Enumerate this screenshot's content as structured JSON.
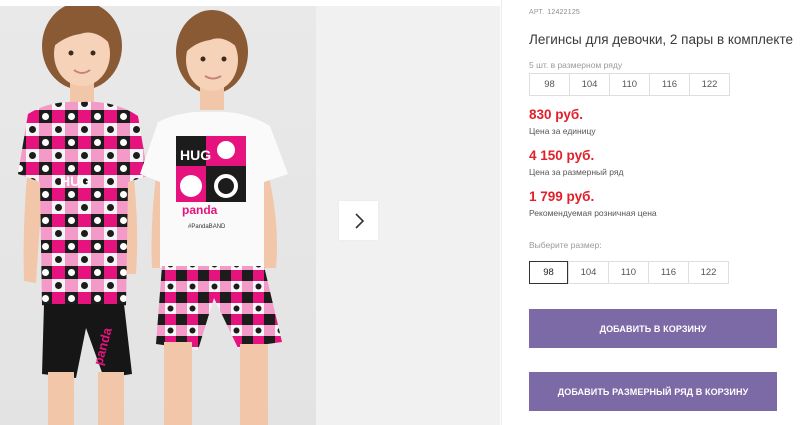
{
  "product": {
    "article_label": "АРТ.",
    "article_value": "12422125",
    "title": "Легинсы для девочки, 2 пары в комплекте"
  },
  "gallery": {
    "next_icon": "chevron-right-icon",
    "print_text_1": "HUG",
    "print_text_2": "panda",
    "print_text_3": "#PandaBAND",
    "print_text_4": "HUG",
    "print_text_5": "panda"
  },
  "row_sizes": {
    "label": "5 шт. в размерном ряду",
    "items": [
      "98",
      "104",
      "110",
      "116",
      "122"
    ]
  },
  "prices": {
    "unit_price": "830 руб.",
    "unit_label": "Цена за единицу",
    "row_price": "4 150 руб.",
    "row_label": "Цена за размерный ряд",
    "retail_price": "1 799 руб.",
    "retail_label": "Рекомендуемая розничная цена"
  },
  "size_select": {
    "label": "Выберите размер:",
    "items": [
      "98",
      "104",
      "110",
      "116",
      "122"
    ],
    "selected": "98"
  },
  "buttons": {
    "add_to_cart": "ДОБАВИТЬ В КОРЗИНУ",
    "add_row_to_cart": "ДОБАВИТЬ РАЗМЕРНЫЙ РЯД В КОРЗИНУ"
  },
  "colors": {
    "accent_button": "#7c6aa6",
    "price": "#e2202b",
    "print_pink": "#e6137e"
  }
}
